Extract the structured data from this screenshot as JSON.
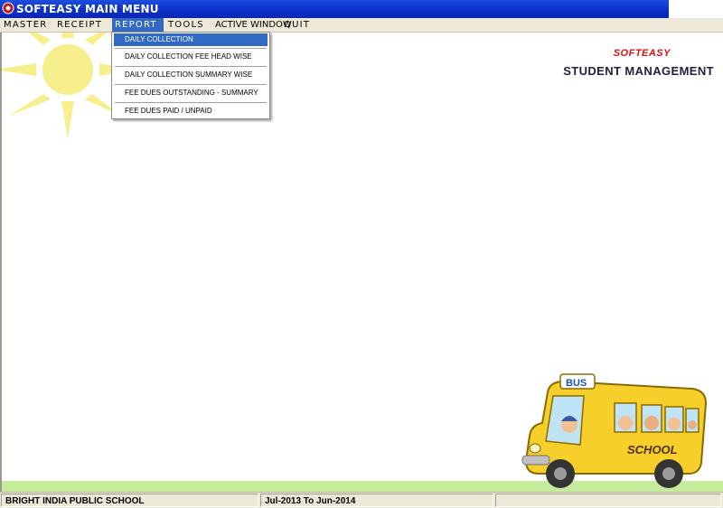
{
  "window": {
    "title": "SOFTEASY MAIN MENU"
  },
  "menubar": {
    "items": [
      {
        "label": "MASTER"
      },
      {
        "label": "RECEIPT"
      },
      {
        "label": "REPORT"
      },
      {
        "label": "TOOLS"
      },
      {
        "label": "ACTIVE WINDOW"
      },
      {
        "label": "QUIT"
      }
    ],
    "active": "REPORT"
  },
  "report_menu": {
    "items": [
      {
        "label": "DAILY COLLECTION",
        "selected": true
      },
      {
        "label": "DAILY COLLECTION FEE HEAD WISE"
      },
      {
        "label": "DAILY COLLECTION SUMMARY WISE"
      },
      {
        "label": "FEE DUES OUTSTANDING - SUMMARY"
      },
      {
        "label": "FEE DUES PAID / UNPAID"
      }
    ]
  },
  "branding": {
    "company": "SOFTEASY",
    "product": "STUDENT MANAGEMENT",
    "company_color": "#d81010"
  },
  "bus": {
    "top_sign": "BUS",
    "side_sign": "SCHOOL"
  },
  "statusbar": {
    "school": "BRIGHT INDIA PUBLIC SCHOOL",
    "session": "Jul-2013 To Jun-2014"
  },
  "colors": {
    "titlebar": "#0a2fc8",
    "menu_highlight": "#316ac5",
    "menubar": "#ece9d8",
    "grass": "#c7ec9c",
    "sun": "#f7ee8c"
  },
  "icons": {
    "app": "softeasy-app-icon",
    "sun": "sun-icon",
    "bus": "school-bus-icon"
  }
}
